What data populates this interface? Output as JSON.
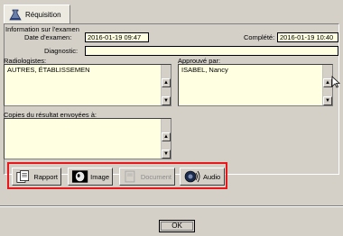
{
  "tab": {
    "label": "Réquisition",
    "icon": "flask-icon"
  },
  "exam": {
    "section_label": "Information sur l'examen",
    "date_label": "Date d'examen:",
    "date_value": "2016-01-19 09:47",
    "completed_label": "Complété:",
    "completed_value": "2016-01-19 10:40",
    "diagnostic_label": "Diagnostic:",
    "diagnostic_value": ""
  },
  "radiologists": {
    "label": "Radiologistes:",
    "value": "AUTRES, ÉTABLISSEMEN"
  },
  "approved": {
    "label": "Approuvé par:",
    "value": "ISABEL, Nancy"
  },
  "copies": {
    "label": "Copies du résultat envoyées à:",
    "value": ""
  },
  "toolbar": {
    "rapport_label": "Rapport",
    "image_label": "Image",
    "document_label": "Document",
    "audio_label": "Audio"
  },
  "footer": {
    "ok_label": "OK"
  },
  "colors": {
    "highlight": "#e8171c",
    "field_bg": "#ffffe1",
    "window_bg": "#d4d0c8"
  }
}
